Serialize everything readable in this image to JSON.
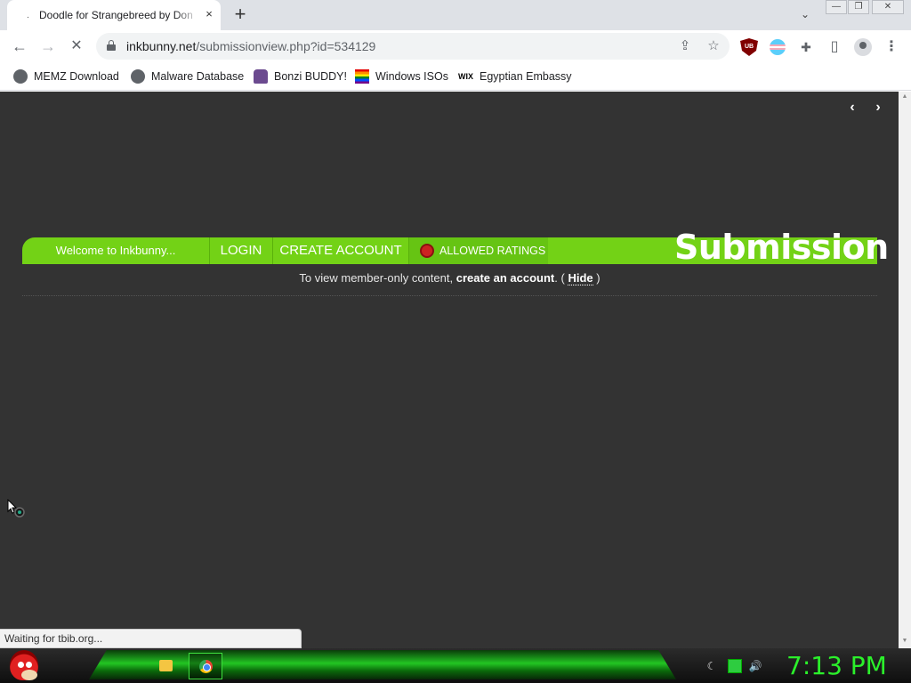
{
  "browser": {
    "tab": {
      "title": "Doodle for Strangebreed by Don",
      "close_icon": "×"
    },
    "new_tab_icon": "+",
    "tab_list_icon": "⌄",
    "window_controls": {
      "minimize": "—",
      "restore": "❐",
      "close": "✕"
    },
    "nav": {
      "back": "←",
      "forward": "→",
      "stop": "✕"
    },
    "url": {
      "host": "inkbunny.net",
      "path": "/submissionview.php?id=534129"
    },
    "omnibox_icons": {
      "share": "⇪",
      "bookmark": "☆"
    },
    "extensions": {
      "ublock_label": "UB",
      "puzzle": "✚",
      "sidebar": "▯",
      "menu": "⋮"
    }
  },
  "bookmarks": [
    {
      "label": "MEMZ Download",
      "icon": "globe-icon"
    },
    {
      "label": "Malware Database",
      "icon": "globe-icon"
    },
    {
      "label": "Bonzi BUDDY!",
      "icon": "bonzi-icon"
    },
    {
      "label": "Windows ISOs",
      "icon": "rainbow-flag-icon"
    },
    {
      "label": "Egyptian Embassy",
      "icon": "wix-icon",
      "icon_text": "WIX"
    }
  ],
  "page": {
    "pager": {
      "prev": "‹",
      "next": "›"
    },
    "nav": {
      "welcome": "Welcome to Inkbunny...",
      "login": "LOGIN",
      "create_account": "CREATE ACCOUNT",
      "allowed_ratings": "ALLOWED RATINGS",
      "section_title": "Submission"
    },
    "notice": {
      "prefix": "To view member-only content,",
      "link": "create an account",
      "middle": ". (",
      "hide": "Hide",
      "suffix": ")"
    },
    "status": "Waiting for tbib.org..."
  },
  "taskbar": {
    "clock": "7:13 PM",
    "colors": {
      "accent": "#2bf02b",
      "page_bg": "#333333",
      "nav_green": "#73d216"
    }
  }
}
